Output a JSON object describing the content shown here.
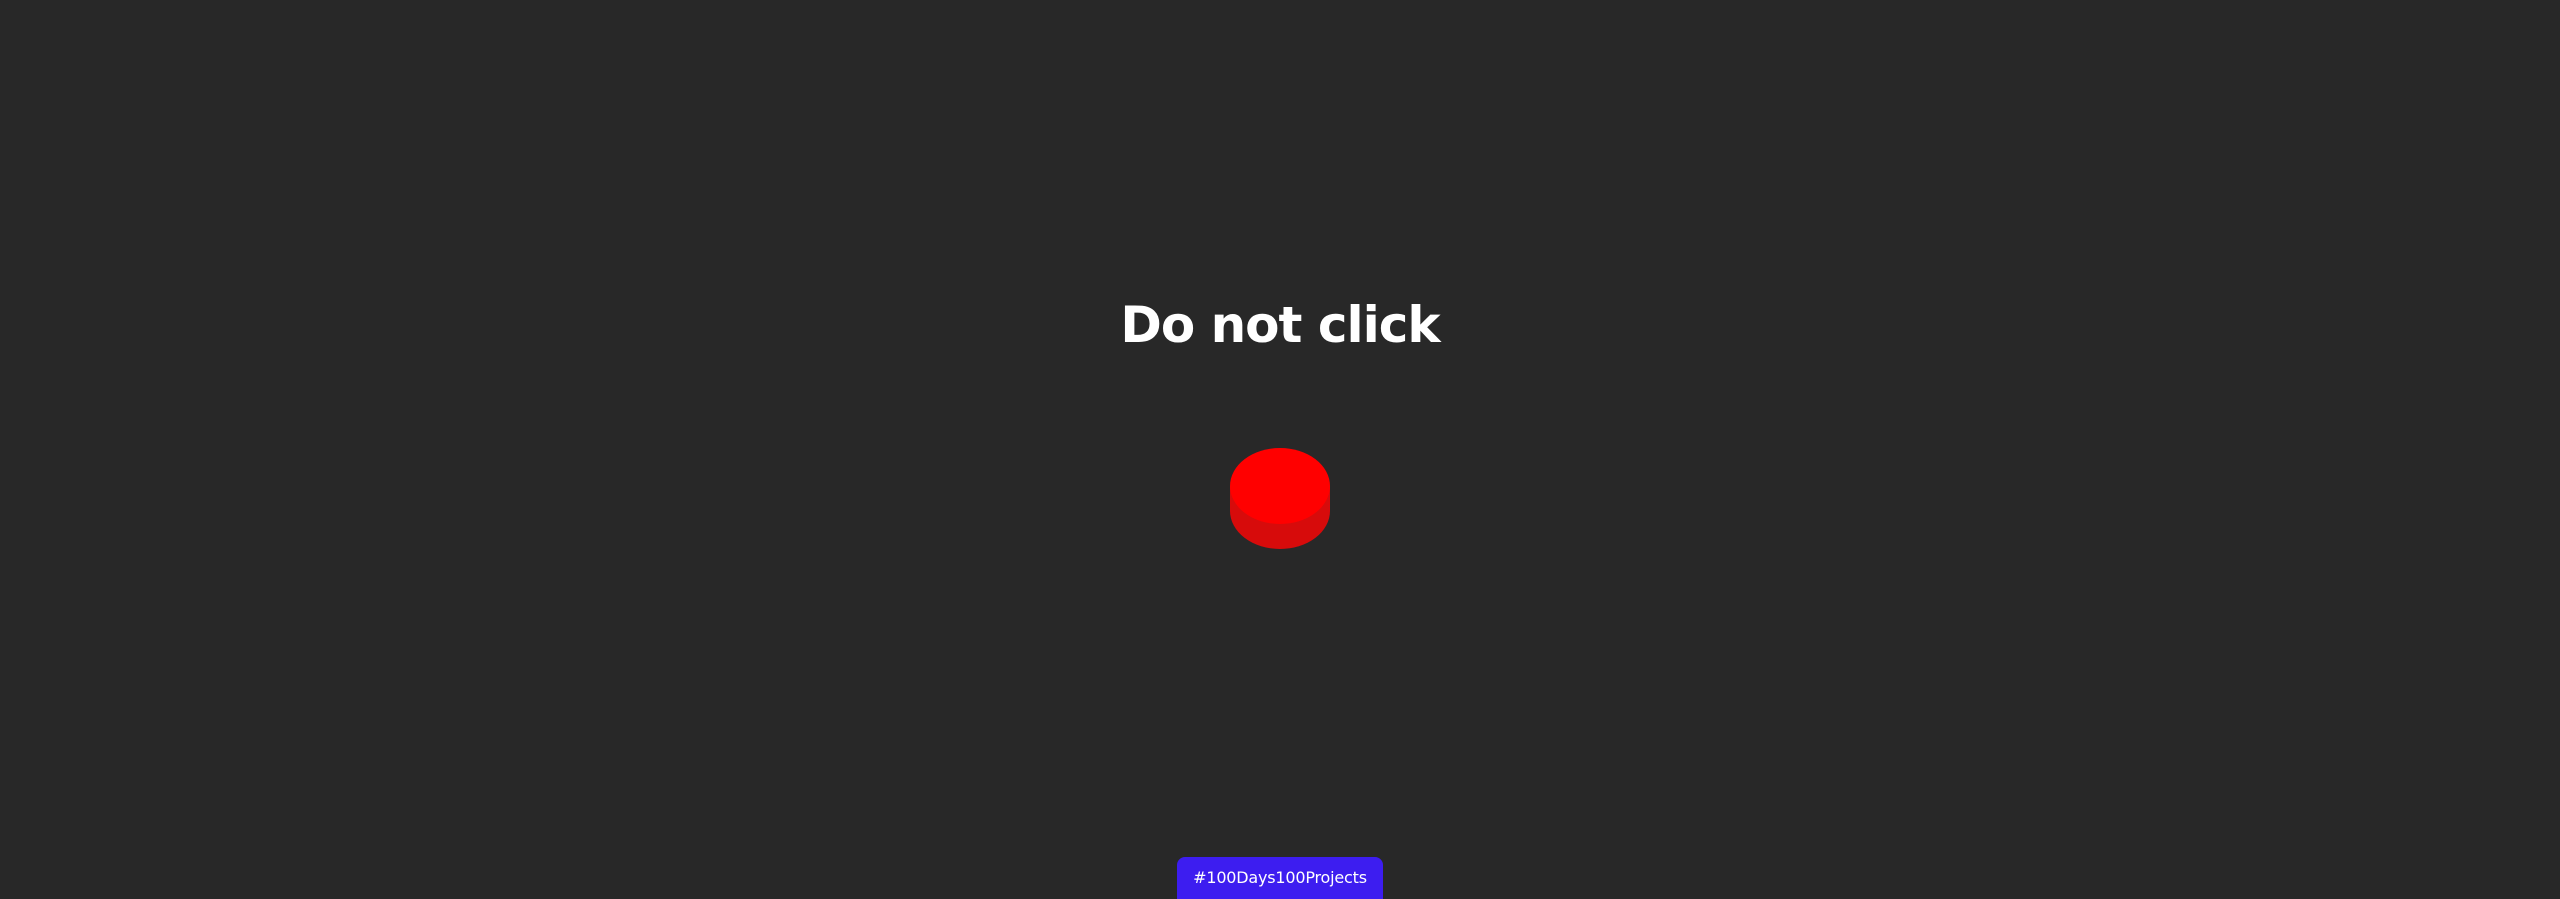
{
  "heading": {
    "text": "Do not click"
  },
  "button": {
    "color_top": "#ff0000",
    "color_side": "#d70b0b"
  },
  "footer_badge": {
    "label": "#100Days100Projects",
    "color": "#3d1df0"
  },
  "theme": {
    "background": "#282828",
    "text": "#ffffff"
  }
}
